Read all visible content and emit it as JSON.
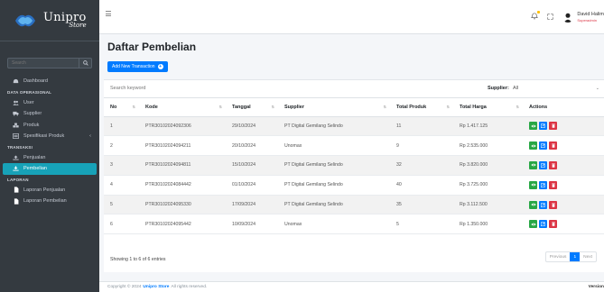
{
  "brand": {
    "name": "Unipro",
    "sub": "Store"
  },
  "sidebar": {
    "search_placeholder": "Search",
    "items": [
      {
        "type": "item",
        "label": "Dashboard",
        "icon": "dashboard-icon"
      },
      {
        "type": "head",
        "label": "DATA OPERASIONAL"
      },
      {
        "type": "item",
        "label": "User",
        "icon": "users-icon"
      },
      {
        "type": "item",
        "label": "Supplier",
        "icon": "truck-icon"
      },
      {
        "type": "item",
        "label": "Produk",
        "icon": "boxes-icon"
      },
      {
        "type": "item",
        "label": "Spesifikasi Produk",
        "icon": "list-icon",
        "arrow": "‹"
      },
      {
        "type": "head",
        "label": "TRANSAKSI"
      },
      {
        "type": "item",
        "label": "Penjualan",
        "icon": "upload-icon"
      },
      {
        "type": "item",
        "label": "Pembelian",
        "icon": "download-icon",
        "active": true
      },
      {
        "type": "head",
        "label": "LAPORAN"
      },
      {
        "type": "item",
        "label": "Laporan Penjualan",
        "icon": "file-icon"
      },
      {
        "type": "item",
        "label": "Laporan Pembelian",
        "icon": "file-icon"
      }
    ]
  },
  "topbar": {
    "user_name": "David Halim",
    "user_role": "Superadmin"
  },
  "page": {
    "title": "Daftar Pembelian",
    "add_button": "Add New Transaction",
    "search_placeholder": "Search keyword",
    "supplier_label": "Supplier:",
    "supplier_value": "All"
  },
  "table": {
    "columns": [
      "No",
      "Kode",
      "Tanggal",
      "Supplier",
      "Total Produk",
      "Total Harga",
      "Actions"
    ],
    "rows": [
      [
        "1",
        "PTR30102024092306",
        "29/10/2024",
        "PT Digital Gemilang Selindo",
        "11",
        "Rp 1.417.125"
      ],
      [
        "2",
        "PTR30102024094211",
        "20/10/2024",
        "Unomax",
        "9",
        "Rp 2.535.000"
      ],
      [
        "3",
        "PTR30102024094811",
        "15/10/2024",
        "PT Digital Gemilang Selindo",
        "32",
        "Rp 3.820.000"
      ],
      [
        "4",
        "PTR30102024084442",
        "01/10/2024",
        "PT Digital Gemilang Selindo",
        "40",
        "Rp 3.725.000"
      ],
      [
        "5",
        "PTR30102024095330",
        "17/09/2024",
        "PT Digital Gemilang Selindo",
        "35",
        "Rp 3.112.500"
      ],
      [
        "6",
        "PTR30102024095442",
        "10/09/2024",
        "Unomax",
        "5",
        "Rp 1.350.000"
      ]
    ]
  },
  "pagination": {
    "info": "Showing 1 to 6 of 6 entries",
    "prev": "Previous",
    "page": "1",
    "next": "Next"
  },
  "footer": {
    "prefix": "Copyright © 2024",
    "brand": "Unipro Store",
    "suffix": "All rights reserved.",
    "version": "Version"
  },
  "colors": {
    "sidebar": "#343a40",
    "active": "#17a2b8",
    "primary": "#007bff",
    "success": "#28a745",
    "danger": "#dc3545"
  }
}
